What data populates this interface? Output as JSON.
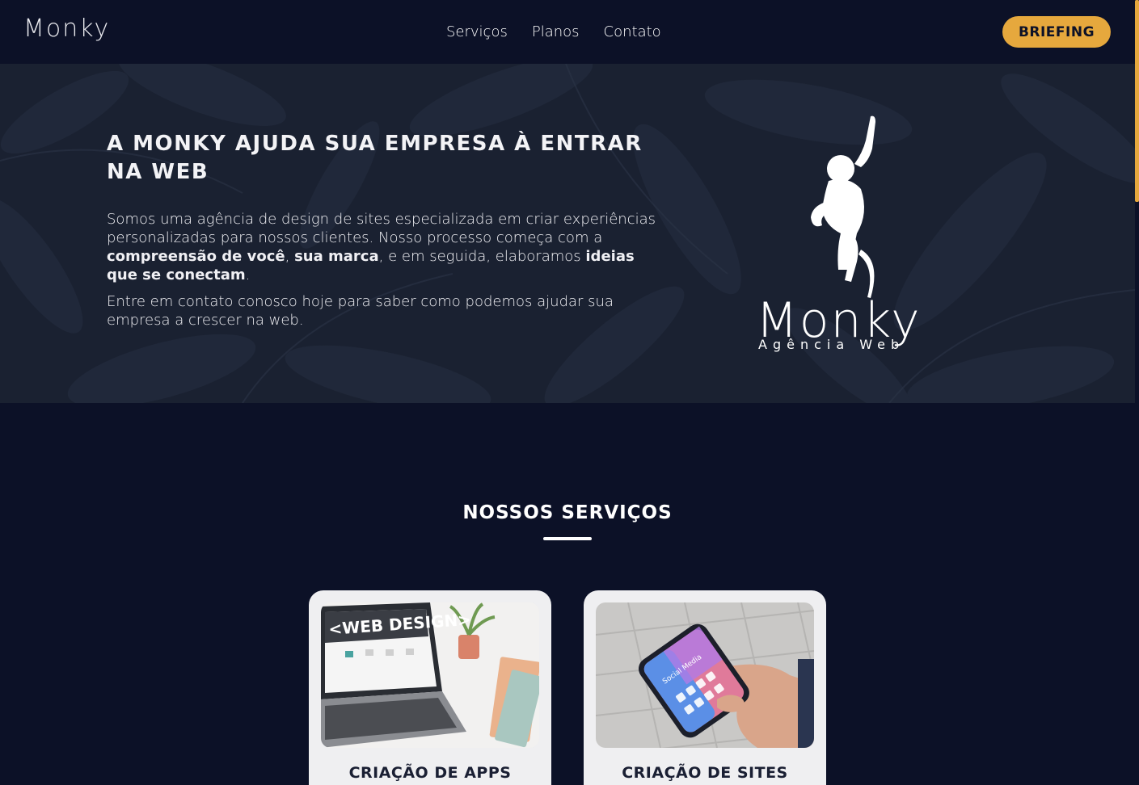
{
  "header": {
    "logo": "Monky",
    "nav": [
      "Serviços",
      "Planos",
      "Contato"
    ],
    "cta_label": "BRIEFING"
  },
  "hero": {
    "title": "A MONKY AJUDA SUA EMPRESA À ENTRAR NA WEB",
    "paragraph1": {
      "t1": "Somos uma agência de design de sites especializada em criar experiências personalizadas para nossos clientes. Nosso processo começa com a ",
      "b1": "compreensão de você",
      "t2": ", ",
      "b2": "sua marca",
      "t3": ", e em seguida, elaboramos ",
      "b3": "ideias que se conectam",
      "t4": "."
    },
    "paragraph2": "Entre em contato conosco hoje para saber como podemos ajudar sua empresa a crescer na web.",
    "logo_text": "Monky",
    "logo_subtitle": "Agência Web"
  },
  "services": {
    "title": "NOSSOS SERVIÇOS",
    "cards": [
      {
        "title": "CRIAÇÃO DE APPS",
        "image_label": "<WEB DESIGN>"
      },
      {
        "title": "CRIAÇÃO DE SITES",
        "image_label": "Social Media"
      }
    ]
  },
  "colors": {
    "background": "#0c1127",
    "accent": "#e6a83d",
    "card": "#efeff1"
  }
}
